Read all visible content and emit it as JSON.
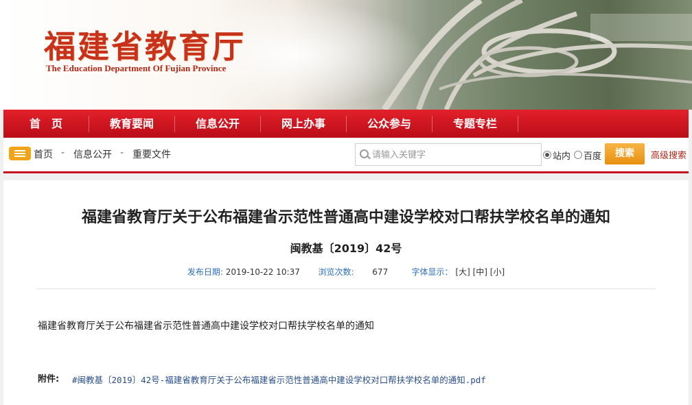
{
  "header": {
    "logo_cn": "福建省教育厅",
    "logo_en": "The Education Department Of Fujian Province"
  },
  "nav": {
    "items": [
      {
        "label": "首　页"
      },
      {
        "label": "教育要闻"
      },
      {
        "label": "信息公开"
      },
      {
        "label": "网上办事"
      },
      {
        "label": "公众参与"
      },
      {
        "label": "专题专栏"
      }
    ]
  },
  "breadcrumb": {
    "icon": "list-icon",
    "items": [
      "首页",
      "信息公开",
      "重要文件"
    ],
    "separator": "-"
  },
  "search": {
    "placeholder": "请输入关键字",
    "value": "",
    "scope_options": [
      {
        "label": "站内",
        "selected": true
      },
      {
        "label": "百度",
        "selected": false
      }
    ],
    "button_label": "搜索",
    "advanced_label": "高级搜索"
  },
  "article": {
    "title": "福建省教育厅关于公布福建省示范性普通高中建设学校对口帮扶学校名单的通知",
    "doc_number": "闽教基〔2019〕42号",
    "meta": {
      "date_label": "发布日期:",
      "date_value": "2019-10-22 10:37",
      "views_label": "浏览次数:",
      "views_value": "677",
      "font_label": "字体显示：",
      "font_large": "[大]",
      "font_medium": "[中]",
      "font_small": "[小]"
    },
    "body": "福建省教育厅关于公布福建省示范性普通高中建设学校对口帮扶学校名单的通知",
    "attachment_label": "附件:",
    "attachment_link": "#闽教基〔2019〕42号-福建省教育厅关于公布福建省示范性普通高中建设学校对口帮扶学校名单的通知.pdf"
  },
  "colors": {
    "nav_red": "#d0141f",
    "logo_red": "#c8321a",
    "search_button": "#f0a21e",
    "link_blue": "#2a6ebb"
  }
}
